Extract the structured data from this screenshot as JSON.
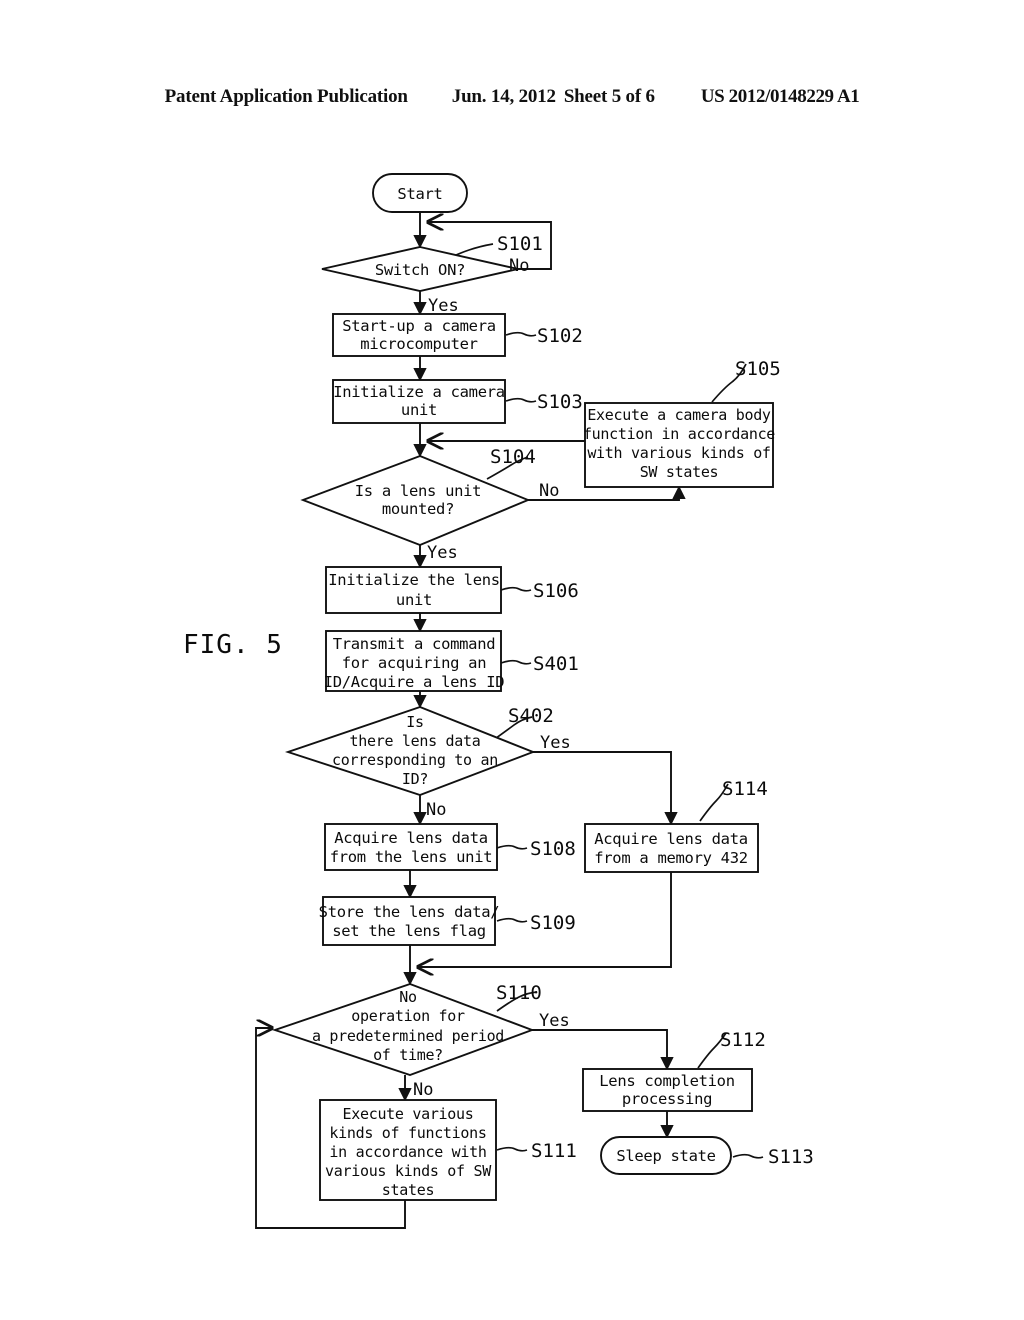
{
  "header": {
    "publication": "Patent Application Publication",
    "date": "Jun. 14, 2012",
    "sheet": "Sheet 5 of 6",
    "document_number": "US 2012/0148229 A1"
  },
  "figure": {
    "label": "FIG. 5"
  },
  "flowchart": {
    "nodes": [
      {
        "id": "start",
        "step": "",
        "shape": "terminator",
        "lines": [
          "Start"
        ]
      },
      {
        "id": "s101",
        "step": "S101",
        "shape": "decision",
        "lines": [
          "Switch ON?"
        ]
      },
      {
        "id": "s102",
        "step": "S102",
        "shape": "process",
        "lines": [
          "Start-up a camera",
          "microcomputer"
        ]
      },
      {
        "id": "s103",
        "step": "S103",
        "shape": "process",
        "lines": [
          "Initialize a camera",
          "unit"
        ]
      },
      {
        "id": "s104",
        "step": "S104",
        "shape": "decision",
        "lines": [
          "Is a lens unit",
          "mounted?"
        ]
      },
      {
        "id": "s105",
        "step": "S105",
        "shape": "process",
        "lines": [
          "Execute a camera body",
          "function in accordance",
          "with various kinds of",
          "SW states"
        ]
      },
      {
        "id": "s106",
        "step": "S106",
        "shape": "process",
        "lines": [
          "Initialize the lens",
          "unit"
        ]
      },
      {
        "id": "s401",
        "step": "S401",
        "shape": "process",
        "lines": [
          "Transmit a command",
          "for acquiring an",
          "ID/Acquire a lens ID"
        ]
      },
      {
        "id": "s402",
        "step": "S402",
        "shape": "decision",
        "lines": [
          "Is",
          "there lens data",
          "corresponding to an",
          "ID?"
        ]
      },
      {
        "id": "s108",
        "step": "S108",
        "shape": "process",
        "lines": [
          "Acquire lens data",
          "from the lens unit"
        ]
      },
      {
        "id": "s114",
        "step": "S114",
        "shape": "process",
        "lines": [
          "Acquire lens data",
          "from a memory 432"
        ]
      },
      {
        "id": "s109",
        "step": "S109",
        "shape": "process",
        "lines": [
          "Store the lens data/",
          "set the lens flag"
        ]
      },
      {
        "id": "s110",
        "step": "S110",
        "shape": "decision",
        "lines": [
          "No",
          "operation for",
          "a predetermined period",
          "of time?"
        ]
      },
      {
        "id": "s111",
        "step": "S111",
        "shape": "process",
        "lines": [
          "Execute various",
          "kinds of functions",
          "in accordance with",
          "various kinds of SW",
          "states"
        ]
      },
      {
        "id": "s112",
        "step": "S112",
        "shape": "process",
        "lines": [
          "Lens completion",
          "processing"
        ]
      },
      {
        "id": "s113",
        "step": "S113",
        "shape": "terminator",
        "lines": [
          "Sleep state"
        ]
      }
    ],
    "branch_labels": {
      "s101_no": "No",
      "s101_yes": "Yes",
      "s104_no": "No",
      "s104_yes": "Yes",
      "s402_yes": "Yes",
      "s402_no": "No",
      "s110_yes": "Yes",
      "s110_no": "No"
    },
    "step_labels": {
      "s101": "S101",
      "s102": "S102",
      "s103": "S103",
      "s104": "S104",
      "s105": "S105",
      "s106": "S106",
      "s401": "S401",
      "s402": "S402",
      "s108": "S108",
      "s114": "S114",
      "s109": "S109",
      "s110": "S110",
      "s111": "S111",
      "s112": "S112",
      "s113": "S113"
    },
    "node_text": {
      "start": "Start",
      "s101_l1": "Switch ON?",
      "s102_l1": "Start-up a camera",
      "s102_l2": "microcomputer",
      "s103_l1": "Initialize a camera",
      "s103_l2": "unit",
      "s104_l1": "Is a lens unit",
      "s104_l2": "mounted?",
      "s105_l1": "Execute a camera body",
      "s105_l2": "function in accordance",
      "s105_l3": "with various kinds of",
      "s105_l4": "SW states",
      "s106_l1": "Initialize the lens",
      "s106_l2": "unit",
      "s401_l1": "Transmit a command",
      "s401_l2": "for acquiring an",
      "s401_l3": "ID/Acquire a lens ID",
      "s402_l1": "Is",
      "s402_l2": "there lens data",
      "s402_l3": "corresponding to an",
      "s402_l4": "ID?",
      "s108_l1": "Acquire lens data",
      "s108_l2": "from the lens unit",
      "s114_l1": "Acquire lens data",
      "s114_l2": "from a memory 432",
      "s109_l1": "Store the lens data/",
      "s109_l2": "set the lens flag",
      "s110_l1": "No",
      "s110_l2": "operation for",
      "s110_l3": "a predetermined period",
      "s110_l4": "of time?",
      "s111_l1": "Execute various",
      "s111_l2": "kinds of functions",
      "s111_l3": "in accordance with",
      "s111_l4": "various kinds of SW",
      "s111_l5": "states",
      "s112_l1": "Lens completion",
      "s112_l2": "processing",
      "s113_l1": "Sleep state"
    },
    "colors": {
      "ink": "#111111",
      "paper": "#ffffff"
    }
  }
}
